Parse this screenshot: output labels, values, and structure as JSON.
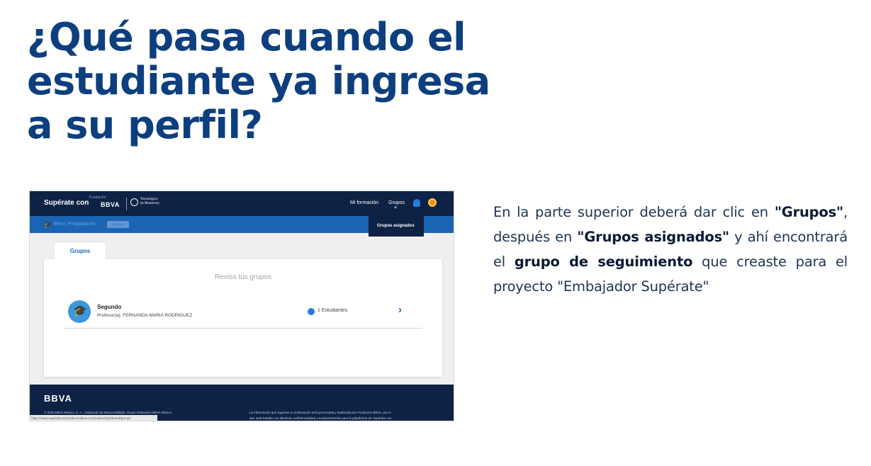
{
  "slide": {
    "title_lines": [
      "¿Qué pasa cuando el",
      "estudiante ya ingresa",
      "a su perfil?"
    ],
    "instructions": {
      "p1": "En la parte superior deberá dar clic en ",
      "b1": "\"Grupos\"",
      "p2": ", después en ",
      "b2": "\"Grupos asignados\"",
      "p3": " y ahí encontrará el ",
      "b3": "grupo de seguimiento",
      "p4": " que creaste para el proyecto \"Embajador Supérate\""
    }
  },
  "screenshot": {
    "header": {
      "brand": "Supérate con",
      "fundacion": "Fundación",
      "bbva": "BBVA",
      "tec_line1": "Tecnológico",
      "tec_line2": "de Monterrey",
      "nav_formacion": "Mi formación",
      "nav_grupos": "Grupos",
      "bell_icon": "bell-icon",
      "avatar_icon": "user-avatar"
    },
    "subbar": {
      "label": "Beca: Preparatoria",
      "badge": "ACTIVO"
    },
    "dropdown": {
      "item": "Grupos asignados"
    },
    "tab_label": "Grupos",
    "card_heading": "Revisa tus grupos",
    "group": {
      "name": "Segundo",
      "professor": "Profesor(a): FERNANDA MARIA RODRIGUEZ",
      "students": "1 Estudiantes",
      "chevron": "›"
    },
    "footer": {
      "logo": "BBVA",
      "left_line1": "© 2022 BBVA México, S. A., Institución de Banca Múltiple, Grupo Financiero BBVA México.",
      "left_line2": "Postal 06600, alcaldía Cuauhtémoc, Ciudad",
      "right_line1": "La información que ingreses a continuación será procesada y analizada por Fundación BBVA, por lo",
      "right_line2": "que será tratada con absoluta confidencialidad y exclusivamente para la plataforma de Supérate con"
    },
    "url": "https://www.superatecon.fundacionbbva.mx/student/dashboard/groups"
  },
  "colors": {
    "title": "#0d3f7e",
    "navy": "#0d2245",
    "blue": "#1b64b3"
  }
}
